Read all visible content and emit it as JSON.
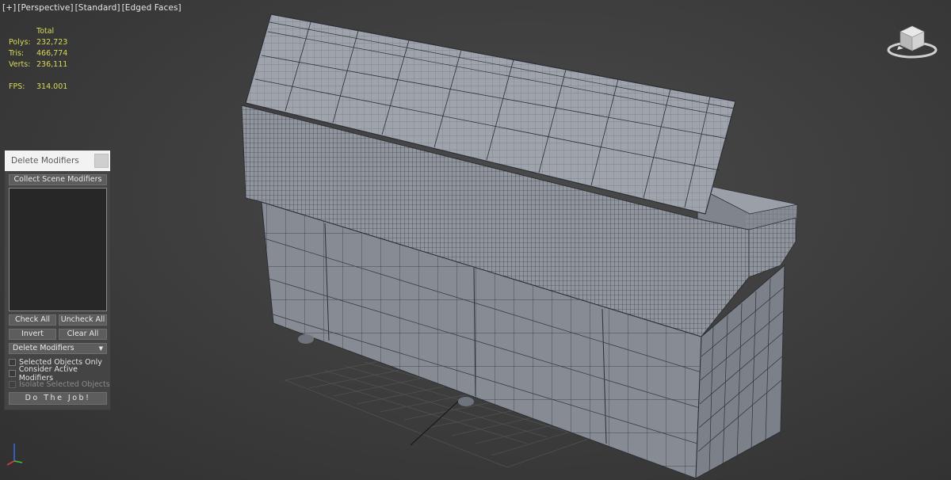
{
  "viewport": {
    "labels": [
      "[+]",
      "[Perspective]",
      "[Standard]",
      "[Edged Faces]"
    ]
  },
  "stats": {
    "header": "Total",
    "rows": [
      {
        "label": "Polys:",
        "value": "232,723"
      },
      {
        "label": "Tris:",
        "value": "466,774"
      },
      {
        "label": "Verts:",
        "value": "236,111"
      }
    ],
    "fps_label": "FPS:",
    "fps_value": "314.001"
  },
  "panel": {
    "title": "Delete Modifiers",
    "collect_button": "Collect Scene Modifiers",
    "check_all": "Check All",
    "uncheck_all": "Uncheck All",
    "invert": "Invert",
    "clear_all": "Clear All",
    "mode_dropdown": "Delete Modifiers",
    "options": [
      {
        "label": "Selected Objects Only",
        "checked": false,
        "enabled": true
      },
      {
        "label": "Consider Active Modifiers",
        "checked": false,
        "enabled": true
      },
      {
        "label": "Isolate Selected Objects",
        "checked": false,
        "enabled": false
      }
    ],
    "do_job": "Do The Job!"
  },
  "icons": {
    "viewcube": "viewcube-icon",
    "axis": "axis-tripod-icon",
    "dropdown": "chevron-down-icon"
  },
  "colors": {
    "viewport_bg": "#3c3c3c",
    "stats_text": "#d8d85a",
    "mesh_face": "#8a8f99",
    "mesh_edge": "#2c2f36"
  }
}
